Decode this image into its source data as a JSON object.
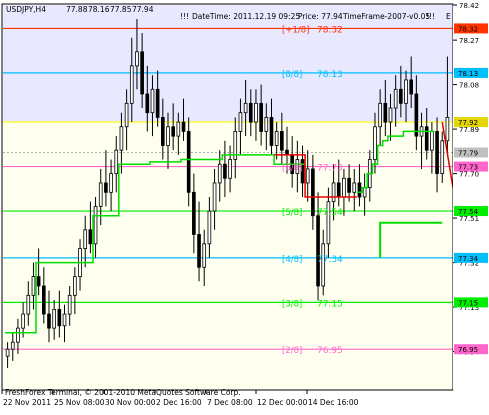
{
  "chart_data": {
    "type": "candlestick",
    "symbol_label": "USDJPY,H4",
    "ohlc_readout": [
      "77.88",
      "78.16",
      "77.85",
      "77.94"
    ],
    "header_info": {
      "marks": "!!!",
      "datetime": "DateTime: 2011.12.19 09:25",
      "price": "Price: 77.94",
      "timeframe": "TimeFrame-2007-v0.05",
      "right_mark": "!!!",
      "extra": "E"
    },
    "footer_text": "FreshForex Terminal, © 2001-2010 MetaQuotes Software Corp.",
    "ylim": [
      76.78,
      78.42
    ],
    "background": {
      "plot": "#ffffff",
      "upper_band": "#e8e8ff",
      "lower_band": "#fffff0",
      "upper_band_from": 77.92,
      "lower_band_to": 77.92
    },
    "y_ticks": [
      "78.42",
      "78.27",
      "78.08",
      "77.89",
      "77.70",
      "77.51",
      "77.32",
      "77.13",
      "76.94",
      "76.75",
      "76.59"
    ],
    "x_ticks": [
      "22 Nov 2011",
      "25 Nov 08:00",
      "30 Nov 00:00",
      "2 Dec 16:00",
      "7 Dec 08:00",
      "12 Dec 00:00",
      "14 Dec 16:00"
    ],
    "murrey_levels": [
      {
        "label": "[+1/8]",
        "value": "78.32",
        "color": "#ff3300",
        "show_text": true
      },
      {
        "label": "[8/8]",
        "value": "78.13",
        "color": "#00bfff",
        "show_text": true
      },
      {
        "label": "[7/8]",
        "value": "77.92",
        "color": "#ffff00",
        "show_text": false
      },
      {
        "label": "[6/8]",
        "value": "77.73",
        "color": "#ff66cc",
        "show_text": true
      },
      {
        "label": "[5/8]",
        "value": "77.54",
        "color": "#00ee00",
        "show_text": true
      },
      {
        "label": "[4/8]",
        "value": "77.34",
        "color": "#00bfff",
        "show_text": true
      },
      {
        "label": "[3/8]",
        "value": "77.15",
        "color": "#00ee00",
        "show_text": true
      },
      {
        "label": "[2/8]",
        "value": "76.95",
        "color": "#ff66cc",
        "show_text": true
      }
    ],
    "level_badges": [
      {
        "value": "78.32",
        "y": 78.32,
        "color": "#ff3300"
      },
      {
        "value": "78.13",
        "y": 78.13,
        "color": "#00bfff"
      },
      {
        "value": "77.92",
        "y": 77.92,
        "color": "#e5d800"
      },
      {
        "value": "77.79",
        "y": 77.79,
        "color": "#c0c0c0"
      },
      {
        "value": "77.73",
        "y": 77.73,
        "color": "#ff66cc"
      },
      {
        "value": "77.54",
        "y": 77.54,
        "color": "#00ee00"
      },
      {
        "value": "77.34",
        "y": 77.34,
        "color": "#00bfff"
      },
      {
        "value": "77.15",
        "y": 77.15,
        "color": "#00ee00"
      },
      {
        "value": "76.95",
        "y": 76.95,
        "color": "#ff66cc"
      }
    ],
    "candles": [
      {
        "o": 76.92,
        "h": 76.98,
        "l": 76.87,
        "c": 76.95
      },
      {
        "o": 76.95,
        "h": 77.02,
        "l": 76.9,
        "c": 76.98
      },
      {
        "o": 76.98,
        "h": 77.08,
        "l": 76.93,
        "c": 77.04
      },
      {
        "o": 77.04,
        "h": 77.15,
        "l": 77.0,
        "c": 77.1
      },
      {
        "o": 77.1,
        "h": 77.24,
        "l": 77.05,
        "c": 77.18
      },
      {
        "o": 77.18,
        "h": 77.32,
        "l": 77.12,
        "c": 77.26
      },
      {
        "o": 77.26,
        "h": 77.38,
        "l": 77.18,
        "c": 77.22
      },
      {
        "o": 77.22,
        "h": 77.3,
        "l": 77.06,
        "c": 77.1
      },
      {
        "o": 77.1,
        "h": 77.2,
        "l": 76.98,
        "c": 77.04
      },
      {
        "o": 77.04,
        "h": 77.16,
        "l": 76.99,
        "c": 77.12
      },
      {
        "o": 77.12,
        "h": 77.2,
        "l": 77.0,
        "c": 77.05
      },
      {
        "o": 77.05,
        "h": 77.14,
        "l": 76.98,
        "c": 77.1
      },
      {
        "o": 77.1,
        "h": 77.22,
        "l": 77.05,
        "c": 77.18
      },
      {
        "o": 77.18,
        "h": 77.3,
        "l": 77.1,
        "c": 77.26
      },
      {
        "o": 77.26,
        "h": 77.42,
        "l": 77.2,
        "c": 77.38
      },
      {
        "o": 77.38,
        "h": 77.52,
        "l": 77.3,
        "c": 77.46
      },
      {
        "o": 77.46,
        "h": 77.58,
        "l": 77.36,
        "c": 77.4
      },
      {
        "o": 77.4,
        "h": 77.6,
        "l": 77.34,
        "c": 77.56
      },
      {
        "o": 77.56,
        "h": 77.72,
        "l": 77.48,
        "c": 77.66
      },
      {
        "o": 77.66,
        "h": 77.8,
        "l": 77.56,
        "c": 77.62
      },
      {
        "o": 77.62,
        "h": 77.76,
        "l": 77.54,
        "c": 77.7
      },
      {
        "o": 77.7,
        "h": 77.86,
        "l": 77.62,
        "c": 77.8
      },
      {
        "o": 77.8,
        "h": 77.96,
        "l": 77.7,
        "c": 77.9
      },
      {
        "o": 77.9,
        "h": 78.06,
        "l": 77.8,
        "c": 78.0
      },
      {
        "o": 78.0,
        "h": 78.28,
        "l": 77.92,
        "c": 78.16
      },
      {
        "o": 78.16,
        "h": 78.36,
        "l": 78.06,
        "c": 78.22
      },
      {
        "o": 78.22,
        "h": 78.3,
        "l": 77.98,
        "c": 78.04
      },
      {
        "o": 78.04,
        "h": 78.16,
        "l": 77.88,
        "c": 77.96
      },
      {
        "o": 77.96,
        "h": 78.12,
        "l": 77.86,
        "c": 78.06
      },
      {
        "o": 78.06,
        "h": 78.14,
        "l": 77.9,
        "c": 77.94
      },
      {
        "o": 77.94,
        "h": 78.02,
        "l": 77.76,
        "c": 77.82
      },
      {
        "o": 77.82,
        "h": 77.96,
        "l": 77.72,
        "c": 77.9
      },
      {
        "o": 77.9,
        "h": 78.0,
        "l": 77.8,
        "c": 77.86
      },
      {
        "o": 77.86,
        "h": 77.96,
        "l": 77.78,
        "c": 77.92
      },
      {
        "o": 77.92,
        "h": 78.02,
        "l": 77.84,
        "c": 77.88
      },
      {
        "o": 77.88,
        "h": 77.94,
        "l": 77.56,
        "c": 77.62
      },
      {
        "o": 77.62,
        "h": 77.7,
        "l": 77.36,
        "c": 77.44
      },
      {
        "o": 77.44,
        "h": 77.58,
        "l": 77.24,
        "c": 77.3
      },
      {
        "o": 77.3,
        "h": 77.46,
        "l": 77.22,
        "c": 77.4
      },
      {
        "o": 77.4,
        "h": 77.6,
        "l": 77.34,
        "c": 77.54
      },
      {
        "o": 77.54,
        "h": 77.72,
        "l": 77.46,
        "c": 77.66
      },
      {
        "o": 77.66,
        "h": 77.8,
        "l": 77.58,
        "c": 77.74
      },
      {
        "o": 77.74,
        "h": 77.84,
        "l": 77.6,
        "c": 77.68
      },
      {
        "o": 77.68,
        "h": 77.82,
        "l": 77.62,
        "c": 77.76
      },
      {
        "o": 77.76,
        "h": 77.94,
        "l": 77.68,
        "c": 77.88
      },
      {
        "o": 77.88,
        "h": 78.02,
        "l": 77.78,
        "c": 77.96
      },
      {
        "o": 77.96,
        "h": 78.1,
        "l": 77.86,
        "c": 78.0
      },
      {
        "o": 78.0,
        "h": 78.06,
        "l": 77.86,
        "c": 77.92
      },
      {
        "o": 77.92,
        "h": 78.06,
        "l": 77.84,
        "c": 78.0
      },
      {
        "o": 78.0,
        "h": 78.08,
        "l": 77.82,
        "c": 77.88
      },
      {
        "o": 77.88,
        "h": 78.0,
        "l": 77.8,
        "c": 77.94
      },
      {
        "o": 77.94,
        "h": 78.02,
        "l": 77.78,
        "c": 77.82
      },
      {
        "o": 77.82,
        "h": 77.92,
        "l": 77.76,
        "c": 77.88
      },
      {
        "o": 77.88,
        "h": 77.96,
        "l": 77.74,
        "c": 77.8
      },
      {
        "o": 77.8,
        "h": 77.9,
        "l": 77.7,
        "c": 77.78
      },
      {
        "o": 77.78,
        "h": 77.86,
        "l": 77.64,
        "c": 77.7
      },
      {
        "o": 77.7,
        "h": 77.84,
        "l": 77.62,
        "c": 77.76
      },
      {
        "o": 77.76,
        "h": 77.82,
        "l": 77.6,
        "c": 77.66
      },
      {
        "o": 77.66,
        "h": 77.8,
        "l": 77.58,
        "c": 77.72
      },
      {
        "o": 77.72,
        "h": 77.78,
        "l": 77.46,
        "c": 77.52
      },
      {
        "o": 77.52,
        "h": 77.62,
        "l": 77.16,
        "c": 77.22
      },
      {
        "o": 77.22,
        "h": 77.46,
        "l": 77.18,
        "c": 77.4
      },
      {
        "o": 77.4,
        "h": 77.64,
        "l": 77.34,
        "c": 77.58
      },
      {
        "o": 77.58,
        "h": 77.74,
        "l": 77.5,
        "c": 77.66
      },
      {
        "o": 77.66,
        "h": 77.76,
        "l": 77.56,
        "c": 77.6
      },
      {
        "o": 77.6,
        "h": 77.72,
        "l": 77.52,
        "c": 77.68
      },
      {
        "o": 77.68,
        "h": 77.74,
        "l": 77.58,
        "c": 77.62
      },
      {
        "o": 77.62,
        "h": 77.72,
        "l": 77.54,
        "c": 77.66
      },
      {
        "o": 77.66,
        "h": 77.74,
        "l": 77.56,
        "c": 77.6
      },
      {
        "o": 77.6,
        "h": 77.7,
        "l": 77.52,
        "c": 77.64
      },
      {
        "o": 77.64,
        "h": 77.8,
        "l": 77.58,
        "c": 77.76
      },
      {
        "o": 77.76,
        "h": 77.96,
        "l": 77.7,
        "c": 77.9
      },
      {
        "o": 77.9,
        "h": 78.06,
        "l": 77.82,
        "c": 78.0
      },
      {
        "o": 78.0,
        "h": 78.1,
        "l": 77.86,
        "c": 77.92
      },
      {
        "o": 77.92,
        "h": 78.04,
        "l": 77.84,
        "c": 77.98
      },
      {
        "o": 77.98,
        "h": 78.12,
        "l": 77.9,
        "c": 78.06
      },
      {
        "o": 78.06,
        "h": 78.16,
        "l": 77.94,
        "c": 78.0
      },
      {
        "o": 78.0,
        "h": 78.14,
        "l": 77.92,
        "c": 78.1
      },
      {
        "o": 78.1,
        "h": 78.2,
        "l": 77.98,
        "c": 78.04
      },
      {
        "o": 78.04,
        "h": 78.12,
        "l": 77.8,
        "c": 77.86
      },
      {
        "o": 77.86,
        "h": 77.96,
        "l": 77.72,
        "c": 77.9
      },
      {
        "o": 77.9,
        "h": 77.98,
        "l": 77.76,
        "c": 77.8
      },
      {
        "o": 77.8,
        "h": 77.92,
        "l": 77.7,
        "c": 77.88
      },
      {
        "o": 77.88,
        "h": 77.94,
        "l": 77.62,
        "c": 77.7
      },
      {
        "o": 77.7,
        "h": 77.88,
        "l": 77.66,
        "c": 77.84
      },
      {
        "o": 77.84,
        "h": 78.2,
        "l": 77.78,
        "c": 77.94
      }
    ],
    "stop_line_green": [
      77.02,
      77.02,
      77.02,
      77.02,
      77.02,
      77.02,
      77.32,
      77.32,
      77.32,
      77.32,
      77.32,
      77.32,
      77.32,
      77.32,
      77.32,
      77.32,
      77.32,
      77.52,
      77.52,
      77.52,
      77.52,
      77.52,
      77.74,
      77.74,
      77.74,
      77.74,
      77.74,
      77.74,
      77.75,
      77.75,
      77.75,
      77.75,
      77.75,
      77.75,
      77.76,
      77.76,
      77.76,
      77.76,
      77.76,
      77.76,
      77.76,
      77.76,
      77.78,
      77.78,
      77.78,
      77.78,
      77.78,
      77.78,
      77.78,
      77.78,
      77.78,
      77.78,
      77.74,
      77.74,
      77.74,
      77.74,
      77.74,
      77.74,
      null,
      null,
      null,
      null,
      null,
      null,
      null,
      null,
      null,
      null,
      77.62,
      77.64,
      77.7,
      77.74,
      77.82,
      77.84,
      77.86,
      77.86,
      77.86,
      77.88,
      77.88,
      77.88,
      77.88,
      77.88,
      77.88,
      null,
      null,
      null
    ],
    "stop_line_red": [
      null,
      null,
      null,
      null,
      null,
      null,
      null,
      null,
      null,
      null,
      null,
      null,
      null,
      null,
      null,
      null,
      null,
      null,
      null,
      null,
      null,
      null,
      null,
      null,
      null,
      null,
      null,
      null,
      null,
      null,
      null,
      null,
      null,
      null,
      null,
      null,
      null,
      null,
      null,
      null,
      null,
      null,
      null,
      null,
      null,
      null,
      null,
      null,
      null,
      null,
      null,
      null,
      77.78,
      77.78,
      77.78,
      77.78,
      77.78,
      77.78,
      77.6,
      77.6,
      77.6,
      77.6,
      77.6,
      77.6,
      77.6,
      77.6,
      77.6,
      77.6,
      null,
      null,
      null,
      null,
      null,
      null,
      null,
      null,
      null,
      null,
      null,
      null,
      null,
      null,
      null,
      null,
      null,
      null
    ],
    "green_segment": {
      "from_index": 72,
      "to_index": 84,
      "y_start": 77.34,
      "y_end": 77.49
    },
    "projection_line": {
      "from_index": 84,
      "to_index": 88,
      "y_start": 77.92,
      "y_end": 77.38,
      "color": "#dd0000"
    },
    "price_line": 77.79
  }
}
